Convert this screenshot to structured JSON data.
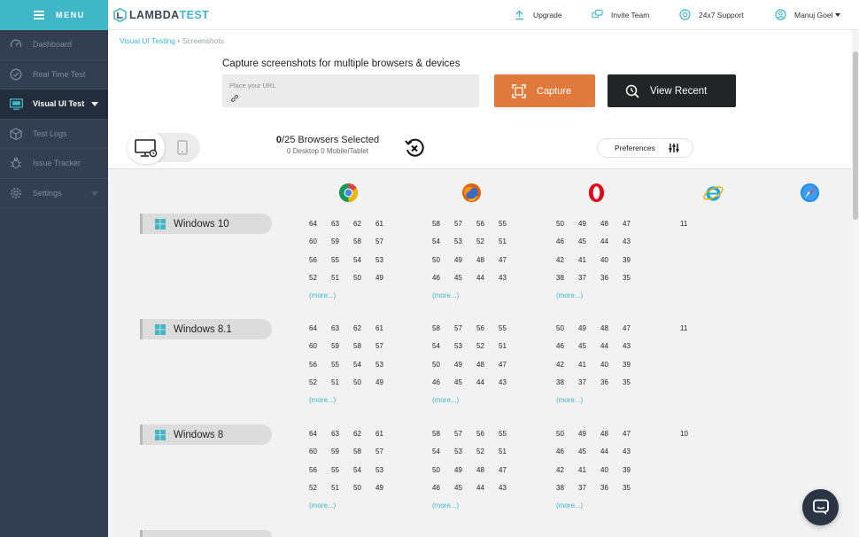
{
  "sidebar": {
    "menu_label": "MENU",
    "items": [
      {
        "label": "Dashboard",
        "icon": "dashboard-icon"
      },
      {
        "label": "Real Time Test",
        "icon": "clock-icon"
      },
      {
        "label": "Visual UI Test",
        "icon": "monitor-icon",
        "active": true
      },
      {
        "label": "Test Logs",
        "icon": "cube-icon"
      },
      {
        "label": "Issue Tracker",
        "icon": "bug-icon"
      },
      {
        "label": "Settings",
        "icon": "gear-icon"
      }
    ]
  },
  "header": {
    "logo_prefix": "LAMBDA",
    "logo_suffix": "TEST",
    "nav": {
      "upgrade": "Upgrade",
      "invite": "Invite Team",
      "support": "24x7 Support",
      "user": "Manuj Goel"
    }
  },
  "breadcrumb": {
    "parent": "Visual UI Testing",
    "separator": "•",
    "current": "Screenshots"
  },
  "capture": {
    "title": "Capture screenshots for multiple browsers & devices",
    "url_placeholder": "Place your URL",
    "capture_label": "Capture",
    "view_recent_label": "View Recent"
  },
  "selection": {
    "count": "0",
    "total": "/25 Browsers Selected",
    "breakdown": "0 Desktop 0 Mobile/Tablet"
  },
  "preferences_label": "Preferences",
  "browsers": [
    "chrome-icon",
    "firefox-icon",
    "opera-icon",
    "ie-icon",
    "safari-icon"
  ],
  "colors": {
    "accent": "#3fb7c6",
    "capture": "#e07a3c",
    "sidebar": "#333e50",
    "dark_button": "#222526"
  },
  "os_groups": [
    {
      "name": "Windows 10",
      "chrome": [
        [
          "64",
          "63",
          "62",
          "61"
        ],
        [
          "60",
          "59",
          "58",
          "57"
        ],
        [
          "56",
          "55",
          "54",
          "53"
        ],
        [
          "52",
          "51",
          "50",
          "49"
        ]
      ],
      "firefox": [
        [
          "58",
          "57",
          "56",
          "55"
        ],
        [
          "54",
          "53",
          "52",
          "51"
        ],
        [
          "50",
          "49",
          "48",
          "47"
        ],
        [
          "46",
          "45",
          "44",
          "43"
        ]
      ],
      "opera": [
        [
          "50",
          "49",
          "48",
          "47"
        ],
        [
          "46",
          "45",
          "44",
          "43"
        ],
        [
          "42",
          "41",
          "40",
          "39"
        ],
        [
          "38",
          "37",
          "36",
          "35"
        ]
      ],
      "ie": "11",
      "more": "(more...)"
    },
    {
      "name": "Windows 8.1",
      "chrome": [
        [
          "64",
          "63",
          "62",
          "61"
        ],
        [
          "60",
          "59",
          "58",
          "57"
        ],
        [
          "56",
          "55",
          "54",
          "53"
        ],
        [
          "52",
          "51",
          "50",
          "49"
        ]
      ],
      "firefox": [
        [
          "58",
          "57",
          "56",
          "55"
        ],
        [
          "54",
          "53",
          "52",
          "51"
        ],
        [
          "50",
          "49",
          "48",
          "47"
        ],
        [
          "46",
          "45",
          "44",
          "43"
        ]
      ],
      "opera": [
        [
          "50",
          "49",
          "48",
          "47"
        ],
        [
          "46",
          "45",
          "44",
          "43"
        ],
        [
          "42",
          "41",
          "40",
          "39"
        ],
        [
          "38",
          "37",
          "36",
          "35"
        ]
      ],
      "ie": "11",
      "more": "(more...)"
    },
    {
      "name": "Windows 8",
      "chrome": [
        [
          "64",
          "63",
          "62",
          "61"
        ],
        [
          "60",
          "59",
          "58",
          "57"
        ],
        [
          "56",
          "55",
          "54",
          "53"
        ],
        [
          "52",
          "51",
          "50",
          "49"
        ]
      ],
      "firefox": [
        [
          "58",
          "57",
          "56",
          "55"
        ],
        [
          "54",
          "53",
          "52",
          "51"
        ],
        [
          "50",
          "49",
          "48",
          "47"
        ],
        [
          "46",
          "45",
          "44",
          "43"
        ]
      ],
      "opera": [
        [
          "50",
          "49",
          "48",
          "47"
        ],
        [
          "46",
          "45",
          "44",
          "43"
        ],
        [
          "42",
          "41",
          "40",
          "39"
        ],
        [
          "38",
          "37",
          "36",
          "35"
        ]
      ],
      "ie": "10",
      "more": "(more...)"
    }
  ]
}
